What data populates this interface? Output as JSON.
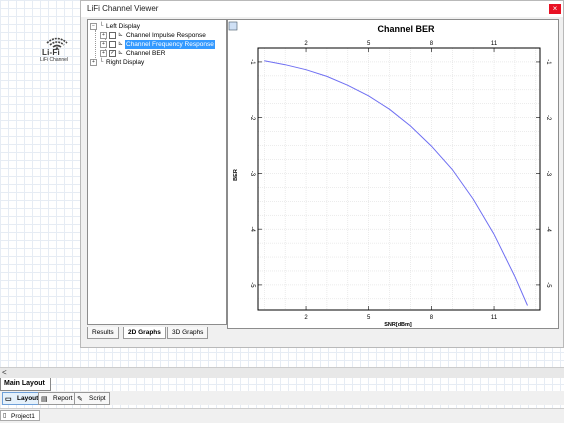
{
  "desktop": {
    "lifi_component": {
      "logo_text": "Li-Fi",
      "caption": "LiFi Channel"
    }
  },
  "window": {
    "title": "LiFi Channel Viewer",
    "close_symbol": "×",
    "tree": {
      "left_display": "Left Display",
      "items": [
        {
          "label": "Channel Impulse Response",
          "checked": false,
          "selected": false
        },
        {
          "label": "Channel Frequency Response",
          "checked": false,
          "selected": true
        },
        {
          "label": "Channel BER",
          "checked": true,
          "selected": false
        }
      ],
      "right_display": "Right Display"
    },
    "tabs": [
      "Results",
      "2D Graphs",
      "3D Graphs"
    ],
    "active_tab": "2D Graphs"
  },
  "chart_data": {
    "type": "line",
    "title": "Channel BER",
    "xlabel": "SNR[dBm]",
    "ylabel": "BER",
    "xlim": [
      -0.3,
      13.2
    ],
    "ylim": [
      -5.45,
      -0.75
    ],
    "x_ticks": [
      2,
      5,
      8,
      11
    ],
    "y_ticks": [
      -1,
      -2,
      -3,
      -4,
      -5
    ],
    "grid": true,
    "color": "#6f6ff2",
    "series": [
      {
        "x": [
          0,
          1,
          2,
          3,
          4,
          5,
          6,
          7,
          8,
          9,
          10,
          11,
          12,
          12.6
        ],
        "y": [
          -0.98,
          -1.05,
          -1.14,
          -1.26,
          -1.42,
          -1.61,
          -1.85,
          -2.15,
          -2.51,
          -2.93,
          -3.46,
          -4.09,
          -4.85,
          -5.37
        ]
      }
    ]
  },
  "bottom": {
    "scroll_arrow": "<",
    "main_layout_tab": "Main Layout",
    "toolbar_buttons": [
      "Layout",
      "Report",
      "Script"
    ],
    "project": "Project1"
  }
}
